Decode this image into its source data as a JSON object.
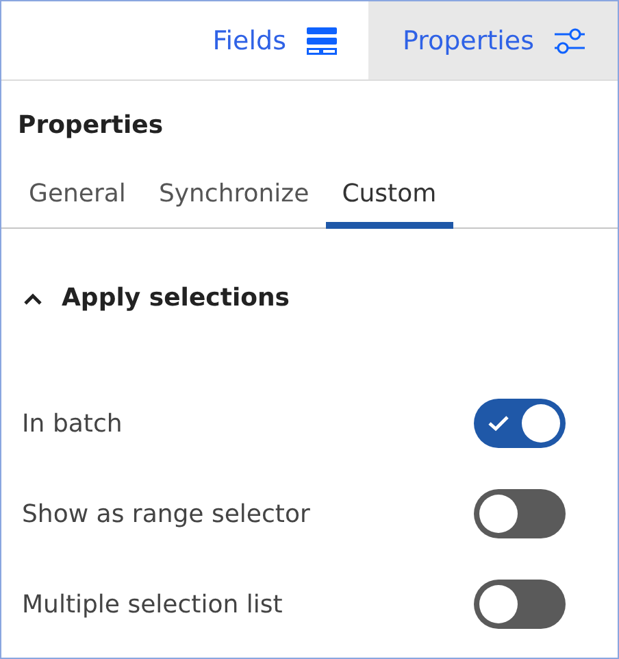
{
  "top_tabs": [
    {
      "label": "Fields",
      "selected": false,
      "kind": "fields"
    },
    {
      "label": "Properties",
      "selected": true,
      "kind": "properties"
    }
  ],
  "panel_title": "Properties",
  "tabs": [
    {
      "label": "General",
      "selected": false
    },
    {
      "label": "Synchronize",
      "selected": false
    },
    {
      "label": "Custom",
      "selected": true
    }
  ],
  "section": {
    "title": "Apply selections",
    "expanded": true
  },
  "options": [
    {
      "label": "In batch",
      "on": true
    },
    {
      "label": "Show as range selector",
      "on": false
    },
    {
      "label": "Multiple selection list",
      "on": false
    }
  ]
}
